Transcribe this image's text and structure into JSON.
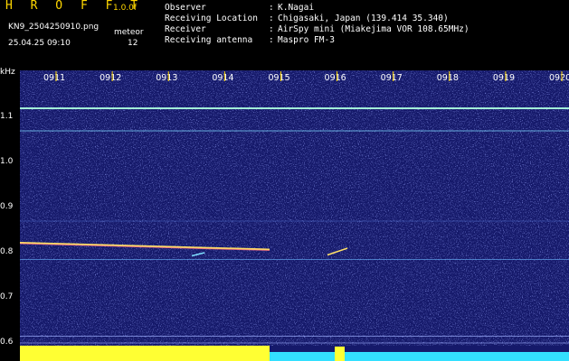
{
  "header": {
    "title": "H R O F F T",
    "version": "1.0.0f",
    "filename": "KN9_2504250910.png",
    "datetime": "25.04.25 09:10",
    "meteor_label": "meteor",
    "meteor_count": "12",
    "info": [
      {
        "label": "Observer",
        "value": "K.Nagai"
      },
      {
        "label": "Receiving Location",
        "value": "Chigasaki, Japan (139.414 35.340)"
      },
      {
        "label": "Receiver",
        "value": "AirSpy mini (Miakejima VOR 108.65MHz)"
      },
      {
        "label": "Receiving antenna",
        "value": "Maspro FM-3"
      }
    ]
  },
  "chart_data": {
    "type": "heatmap",
    "ylabel": "kHz",
    "x_ticks": [
      "0911",
      "0912",
      "0913",
      "0914",
      "0915",
      "0916",
      "0917",
      "0918",
      "0919",
      "0920"
    ],
    "y_ticks": [
      "1.1",
      "1.0",
      "0.9",
      "0.8",
      "0.7",
      "0.6"
    ],
    "ylim": [
      0.58,
      1.18
    ],
    "signal_lines_khz": [
      1.12,
      1.07,
      0.82,
      0.87,
      0.785,
      0.615,
      0.6
    ],
    "colors": {
      "background": "#1a1d6e",
      "noise": "#3a47b8",
      "signal": "#9fffd0",
      "bottom_bar_left": "#ffff33",
      "bottom_bar_right": "#33e0ff"
    }
  }
}
